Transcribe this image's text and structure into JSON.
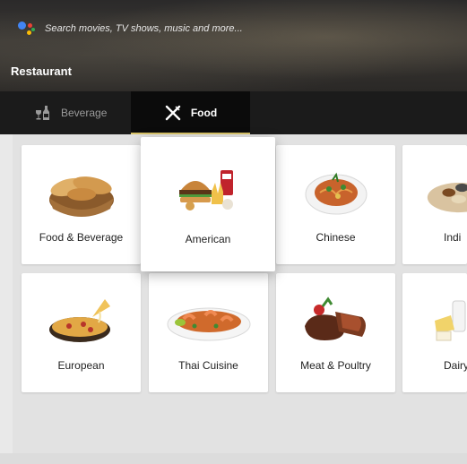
{
  "search": {
    "placeholder": "Search movies, TV shows, music and more..."
  },
  "app": {
    "title": "Restaurant"
  },
  "tabs": [
    {
      "label": "Beverage",
      "icon": "wine-bottle-glass-icon",
      "selected": false
    },
    {
      "label": "Food",
      "icon": "fork-knife-icon",
      "selected": true
    }
  ],
  "categories": [
    {
      "label": "Food & Beverage",
      "icon": "bread-basket-icon"
    },
    {
      "label": "American",
      "icon": "burger-fries-icon",
      "focused": true
    },
    {
      "label": "Chinese",
      "icon": "noodle-bowl-icon"
    },
    {
      "label": "Indi",
      "icon": "indian-platter-icon"
    },
    {
      "label": "European",
      "icon": "pizza-icon"
    },
    {
      "label": "Thai Cuisine",
      "icon": "shrimp-platter-icon"
    },
    {
      "label": "Meat & Poultry",
      "icon": "steak-icon"
    },
    {
      "label": "Dairy F",
      "icon": "dairy-icon"
    }
  ],
  "colors": {
    "accent": "#d9c46a",
    "tab_bar": "#1b1b1b",
    "selected_tab": "#0b0b0b"
  }
}
